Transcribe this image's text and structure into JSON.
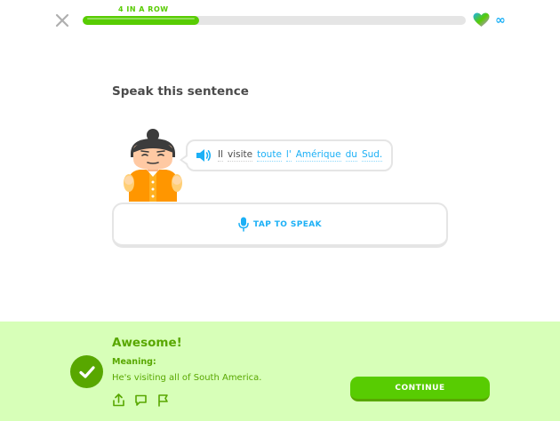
{
  "header": {
    "streak_label": "4 IN A ROW",
    "progress": 0.305,
    "hearts_value": "∞",
    "colors": {
      "progress": "#58cc02",
      "track": "#e5e5e5",
      "heart": "#1cb0f6"
    }
  },
  "exercise": {
    "prompt": "Speak this sentence",
    "sentence_words": [
      {
        "text": "Il",
        "new": false
      },
      {
        "text": "visite",
        "new": false
      },
      {
        "text": "toute",
        "new": true
      },
      {
        "text": "l'",
        "new": true
      },
      {
        "text": "Amérique",
        "new": true
      },
      {
        "text": "du",
        "new": true
      },
      {
        "text": "Sud.",
        "new": true
      }
    ],
    "tap_to_speak_label": "TAP TO SPEAK",
    "icons": {
      "speaker": "speaker-icon",
      "microphone": "microphone-icon"
    }
  },
  "feedback": {
    "title": "Awesome!",
    "meaning_label": "Meaning:",
    "meaning": "He's visiting all of South America.",
    "continue_label": "CONTINUE",
    "actions": [
      "share-icon",
      "comment-icon",
      "report-flag-icon"
    ],
    "colors": {
      "background": "#d7ffb8",
      "accent": "#58a700",
      "button": "#58cc02"
    }
  }
}
